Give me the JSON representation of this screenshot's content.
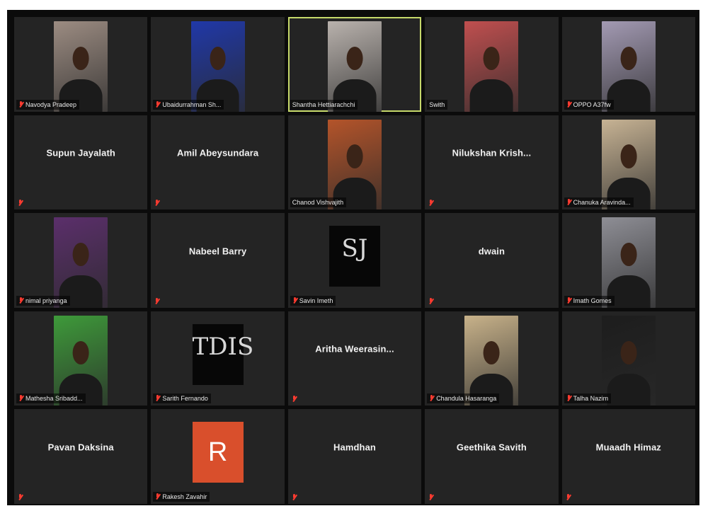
{
  "meeting": {
    "participants": [
      {
        "name": "Navodya Pradeep",
        "muted": true,
        "type": "video",
        "tone": "#9c8c82",
        "active": false
      },
      {
        "name": "Ubaidurrahman Sh...",
        "muted": true,
        "type": "video",
        "tone": "#2038a8",
        "active": false
      },
      {
        "name": "Shantha Hettiarachchi",
        "muted": false,
        "type": "video",
        "tone": "#b9b2ad",
        "active": true
      },
      {
        "name": "Swith",
        "muted": false,
        "type": "video",
        "tone": "#c04f4f",
        "active": false
      },
      {
        "name": "OPPO A37fw",
        "muted": true,
        "type": "video",
        "tone": "#a39ab3",
        "active": false
      },
      {
        "name": "Supun Jayalath",
        "muted": true,
        "type": "name",
        "active": false
      },
      {
        "name": "Amil Abeysundara",
        "muted": true,
        "type": "name",
        "active": false
      },
      {
        "name": "Chanod Vishvajith",
        "muted": false,
        "type": "video",
        "tone": "#b4542a",
        "active": false
      },
      {
        "name": "Nilukshan Krish...",
        "muted": true,
        "type": "name",
        "active": false
      },
      {
        "name": "Chanuka Aravinda...",
        "muted": true,
        "type": "video",
        "tone": "#c7b394",
        "active": false
      },
      {
        "name": "nimal priyanga",
        "muted": true,
        "type": "video",
        "tone": "#5b2f6b",
        "active": false
      },
      {
        "name": "Nabeel Barry",
        "muted": true,
        "type": "name",
        "active": false
      },
      {
        "name": "Savin Imeth",
        "muted": true,
        "type": "logo",
        "logo_mark": "SJ",
        "logo_sub": "",
        "active": false
      },
      {
        "name": "dwain",
        "muted": true,
        "type": "name",
        "active": false
      },
      {
        "name": "Imath Gomes",
        "muted": true,
        "type": "video",
        "tone": "#8e8e95",
        "active": false
      },
      {
        "name": "Mathesha Sribadd...",
        "muted": true,
        "type": "video",
        "tone": "#3e9a3a",
        "active": false
      },
      {
        "name": "Sarith Fernando",
        "muted": true,
        "type": "logo",
        "logo_mark": "TDIS",
        "logo_sub": "",
        "active": false
      },
      {
        "name": "Aritha Weerasin...",
        "muted": true,
        "type": "name",
        "active": false
      },
      {
        "name": "Chandula Hasaranga",
        "muted": true,
        "type": "video",
        "tone": "#c8b28a",
        "active": false
      },
      {
        "name": "Talha Nazim",
        "muted": true,
        "type": "video",
        "tone": "#1d1d1d",
        "active": false
      },
      {
        "name": "Pavan Daksina",
        "muted": true,
        "type": "name",
        "active": false
      },
      {
        "name": "Rakesh Zavahir",
        "muted": true,
        "type": "avatar",
        "letter": "R",
        "active": false
      },
      {
        "name": "Hamdhan",
        "muted": true,
        "type": "name",
        "active": false
      },
      {
        "name": "Geethika Savith",
        "muted": true,
        "type": "name",
        "active": false
      },
      {
        "name": "Muaadh Himaz",
        "muted": true,
        "type": "name",
        "active": false
      }
    ]
  }
}
